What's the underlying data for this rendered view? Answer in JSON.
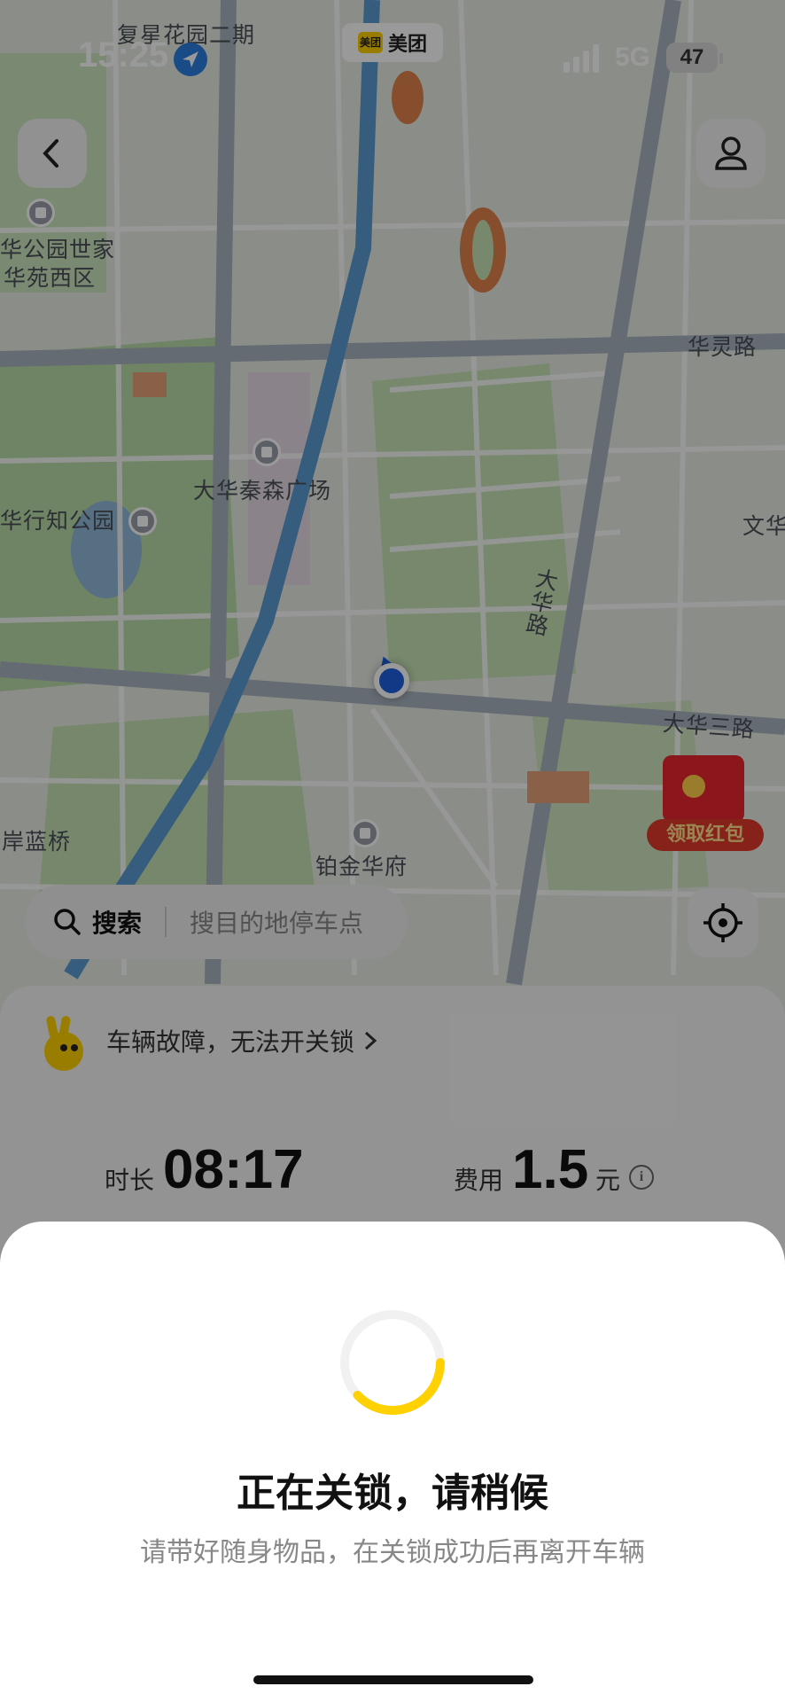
{
  "status_bar": {
    "time": "15:25",
    "app_chip_label": "美团",
    "app_chip_icon_text": "美团",
    "network": "5G",
    "battery": "47"
  },
  "map": {
    "labels": {
      "top_estate": "复星花园二期",
      "park_line1": "华公园世家",
      "park_line2": "华苑西区",
      "road_hualing": "华灵路",
      "plaza": "大华秦森广场",
      "park_zhi": "华行知公园",
      "wen": "文华",
      "road_dahua_vertical": "大华路",
      "road_dahua_three": "大华三路",
      "bridge": "岸蓝桥",
      "residence": "铂金华府",
      "red_packet": "领取红包"
    }
  },
  "search": {
    "label": "搜索",
    "placeholder": "搜目的地停车点"
  },
  "notice": {
    "text": "车辆故障，无法开关锁"
  },
  "trip": {
    "duration_label": "时长",
    "duration_value": "08:17",
    "fee_label": "费用",
    "fee_value": "1.5",
    "fee_unit": "元"
  },
  "sheet": {
    "title": "正在关锁，请稍候",
    "subtitle": "请带好随身物品，在关锁成功后再离开车辆",
    "progress": 0.38
  },
  "icons": {
    "back": "chevron-left-icon",
    "profile": "user-icon",
    "search": "search-icon",
    "locate": "locate-crosshair-icon",
    "mascot": "kangaroo-mascot-icon",
    "info": "info-icon"
  },
  "colors": {
    "accent_yellow": "#FFD100",
    "location_blue": "#1E5FE0",
    "red_packet": "#E8252D"
  }
}
